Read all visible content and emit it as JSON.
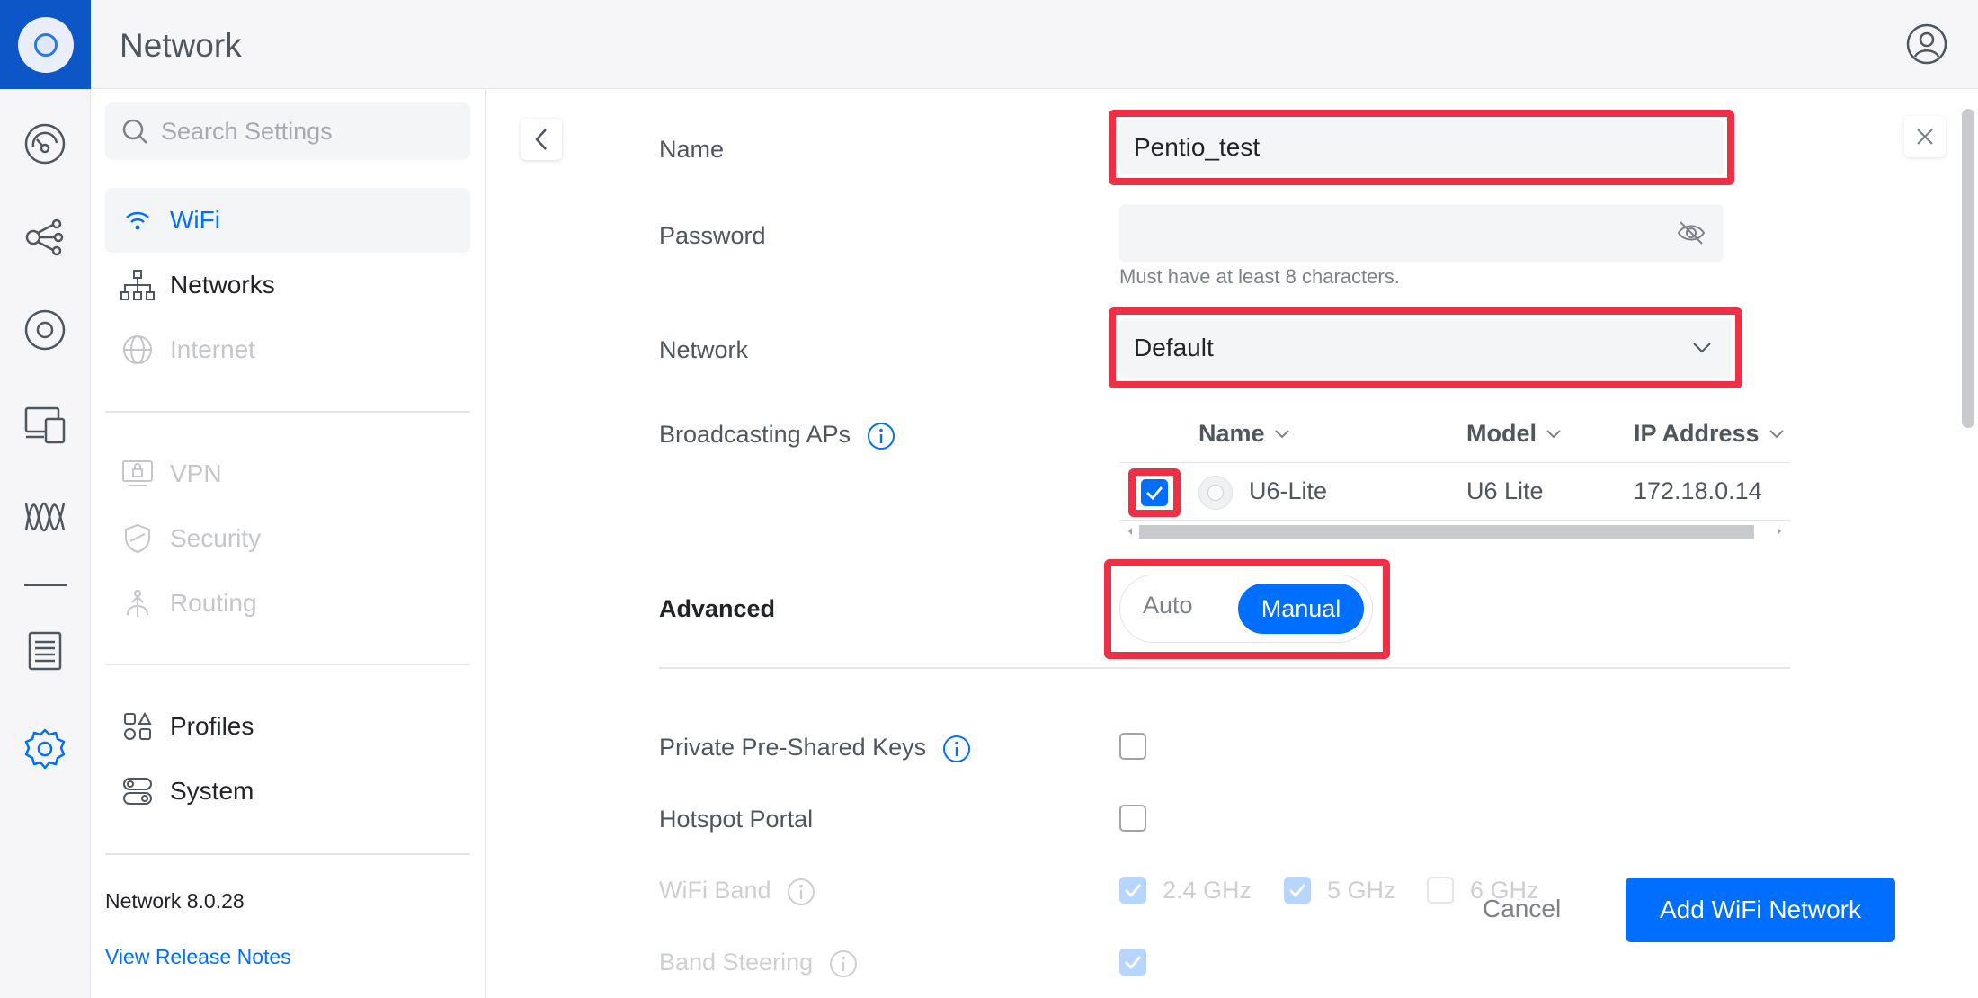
{
  "app": {
    "title": "Network"
  },
  "search": {
    "placeholder": "Search Settings"
  },
  "sidebar": {
    "items": [
      {
        "label": "WiFi",
        "icon": "wifi-icon",
        "state": "active"
      },
      {
        "label": "Networks",
        "icon": "network-tree-icon",
        "state": "normal"
      },
      {
        "label": "Internet",
        "icon": "globe-icon",
        "state": "disabled"
      },
      {
        "label": "VPN",
        "icon": "vpn-icon",
        "state": "disabled"
      },
      {
        "label": "Security",
        "icon": "shield-icon",
        "state": "disabled"
      },
      {
        "label": "Routing",
        "icon": "routing-icon",
        "state": "disabled"
      },
      {
        "label": "Profiles",
        "icon": "profiles-icon",
        "state": "normal"
      },
      {
        "label": "System",
        "icon": "system-icon",
        "state": "normal"
      }
    ],
    "version": "Network 8.0.28",
    "release_notes": "View Release Notes"
  },
  "form": {
    "name_label": "Name",
    "name_value": "Pentio_test",
    "password_label": "Password",
    "password_value": "",
    "password_hint": "Must have at least 8 characters.",
    "network_label": "Network",
    "network_value": "Default",
    "broadcasting_label": "Broadcasting APs",
    "ap_table": {
      "columns": [
        "Name",
        "Model",
        "IP Address"
      ],
      "rows": [
        {
          "checked": true,
          "name": "U6-Lite",
          "model": "U6 Lite",
          "ip": "172.18.0.14"
        }
      ]
    },
    "advanced_label": "Advanced",
    "advanced_options": [
      "Auto",
      "Manual"
    ],
    "advanced_selected": "Manual",
    "ppsk_label": "Private Pre-Shared Keys",
    "hotspot_label": "Hotspot Portal",
    "wifi_band_label": "WiFi Band",
    "bands": [
      {
        "label": "2.4 GHz",
        "checked": true
      },
      {
        "label": "5 GHz",
        "checked": true
      },
      {
        "label": "6 GHz",
        "checked": false
      }
    ],
    "band_steering_label": "Band Steering"
  },
  "actions": {
    "cancel": "Cancel",
    "submit": "Add WiFi Network"
  },
  "colors": {
    "accent": "#006fff",
    "highlight": "#ee3047",
    "logo_bg": "#0d56c8"
  }
}
